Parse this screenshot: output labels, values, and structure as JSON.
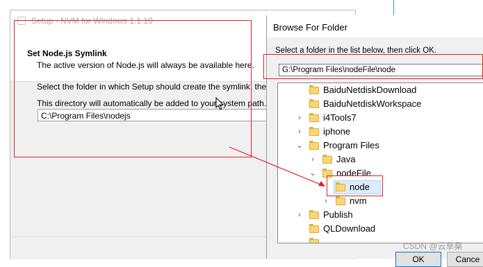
{
  "setup": {
    "title": "Setup - NVM for Windows 1.1.10",
    "heading": "Set Node.js Symlink",
    "subheading": "The active version of Node.js will always be available here.",
    "body_line1": "Select the folder in which Setup should create the symlink, then click N",
    "body_line2": "This directory will automatically be added to your system path.",
    "path_value": "C:\\Program Files\\nodejs"
  },
  "browse": {
    "title": "Browse For Folder",
    "instruction": "Select a folder in the list below, then click OK.",
    "path_value": "G:\\Program Files\\nodeFile\\node",
    "tree": [
      {
        "label": "BaiduNetdiskDownload",
        "expander": ""
      },
      {
        "label": "BaiduNetdiskWorkspace",
        "expander": ""
      },
      {
        "label": "i4Tools7",
        "expander": "›"
      },
      {
        "label": "iphone",
        "expander": "›"
      },
      {
        "label": "Program Files",
        "expander": "⌄"
      },
      {
        "label": "Java",
        "expander": "›"
      },
      {
        "label": "nodeFile",
        "expander": "⌄"
      },
      {
        "label": "node",
        "expander": ""
      },
      {
        "label": "nvm",
        "expander": "›"
      },
      {
        "label": "Publish",
        "expander": "›"
      },
      {
        "label": "QLDownload",
        "expander": ""
      }
    ],
    "ok_label": "OK",
    "cancel_label": "Cance"
  },
  "watermark": "CSDN @云草桑",
  "colors": {
    "annotation": "#e02020",
    "selection": "#dcecfc",
    "folder": "#fcd672"
  }
}
